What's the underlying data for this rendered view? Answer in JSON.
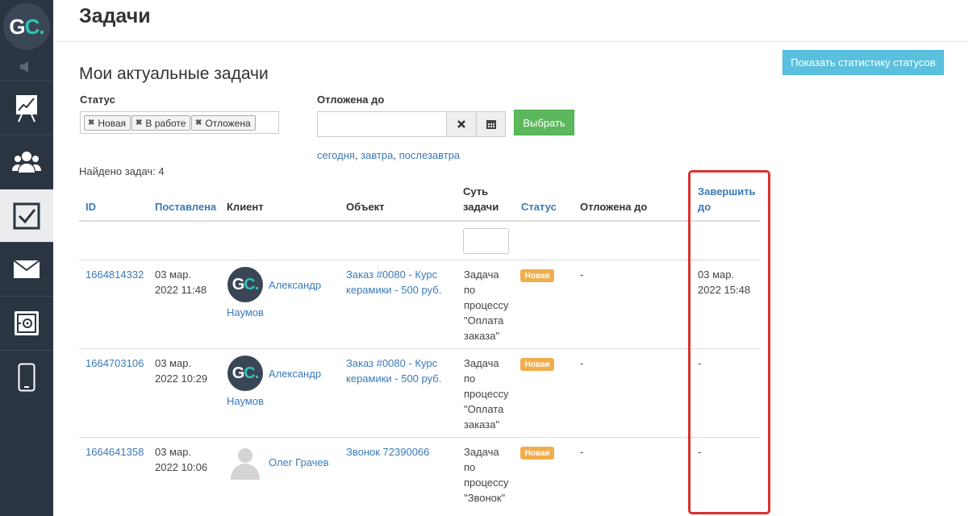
{
  "logo": {
    "g": "G",
    "c": "C."
  },
  "header": {
    "title": "Задачи"
  },
  "stats_button": "Показать статистику статусов",
  "section_title": "Мои актуальные задачи",
  "filters": {
    "status_label": "Статус",
    "status_tags": [
      "Новая",
      "В работе",
      "Отложена"
    ],
    "postponed_label": "Отложена до",
    "postponed_value": "",
    "choose_button": "Выбрать",
    "quick_dates": [
      "сегодня",
      "завтра",
      "послезавтра"
    ],
    "date_separator": ", "
  },
  "found_text": "Найдено задач: 4",
  "table": {
    "headers": {
      "id": "ID",
      "created": "Поставлена",
      "client": "Клиент",
      "object": "Объект",
      "essence_line1": "Суть",
      "essence_line2": "задачи",
      "status": "Статус",
      "postponed": "Отложена до",
      "deadline_line1": "Завершить",
      "deadline_line2": "до"
    },
    "rows": [
      {
        "id": "1664814332",
        "created_l1": "03 мар.",
        "created_l2": "2022 11:48",
        "client_first": "Александр",
        "client_last": "Наумов",
        "object_l1": "Заказ #0080 - Курс",
        "object_l2": "керамики - 500 руб.",
        "essence": [
          "Задача",
          "по",
          "процессу",
          "\"Оплата",
          "заказа\""
        ],
        "status": "Новая",
        "postponed": "-",
        "deadline_l1": "03 мар.",
        "deadline_l2": "2022 15:48"
      },
      {
        "id": "1664703106",
        "created_l1": "03 мар.",
        "created_l2": "2022 10:29",
        "client_first": "Александр",
        "client_last": "Наумов",
        "object_l1": "Заказ #0080 - Курс",
        "object_l2": "керамики - 500 руб.",
        "essence": [
          "Задача",
          "по",
          "процессу",
          "\"Оплата",
          "заказа\""
        ],
        "status": "Новая",
        "postponed": "-",
        "deadline_l1": "-",
        "deadline_l2": ""
      },
      {
        "id": "1664641358",
        "created_l1": "03 мар.",
        "created_l2": "2022 10:06",
        "client_first": "Олег Грачев",
        "client_last": "",
        "object_l1": "Звонок 72390066",
        "object_l2": "",
        "essence": [
          "Задача",
          "по",
          "процессу",
          "\"Звонок\""
        ],
        "status": "Новая",
        "postponed": "-",
        "deadline_l1": "-",
        "deadline_l2": ""
      }
    ]
  },
  "colors": {
    "sidebar": "#2b3542",
    "accent_link": "#3a7ab8",
    "info_button": "#5bc0de",
    "success_button": "#5cb85c",
    "badge_new": "#f0ad4e",
    "highlight": "#d9322f",
    "logo_teal": "#2ec4b6"
  },
  "icons": {
    "sidebar": [
      "speaker-icon",
      "chart-board-icon",
      "users-icon",
      "tasks-check-icon",
      "mail-icon",
      "safe-icon",
      "phone-icon"
    ],
    "date_clear": "close-icon",
    "date_calendar": "calendar-icon"
  }
}
